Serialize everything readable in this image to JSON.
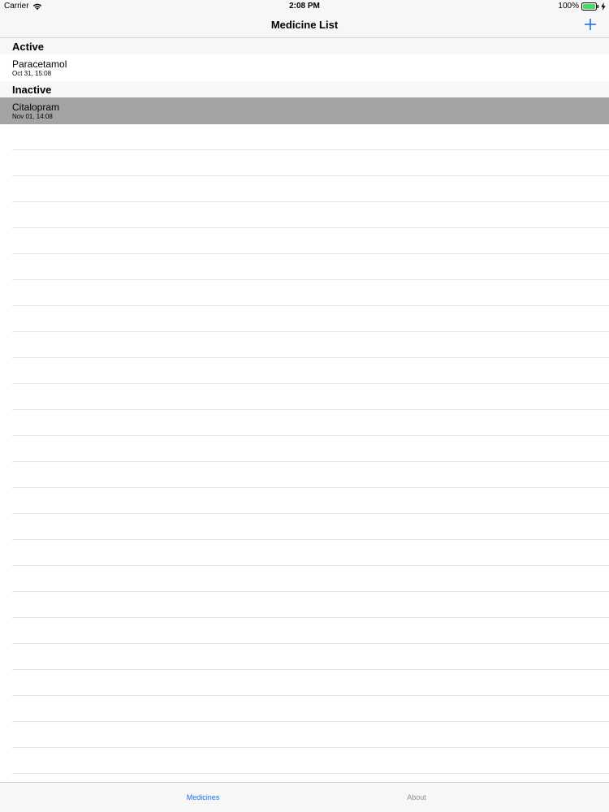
{
  "status_bar": {
    "carrier": "Carrier",
    "time": "2:08 PM",
    "battery": "100%"
  },
  "nav": {
    "title": "Medicine List",
    "add_icon": "plus-icon"
  },
  "colors": {
    "accent": "#1a73e8",
    "selected_row": "#a3a3a3",
    "battery_green": "#4cd964",
    "inactive_tab": "#8e8e93"
  },
  "sections": [
    {
      "header": "Active",
      "items": [
        {
          "name": "Paracetamol",
          "date": "Oct 31, 15:08"
        }
      ]
    },
    {
      "header": "Inactive",
      "items": [
        {
          "name": "Citalopram",
          "date": "Nov 01, 14:08"
        }
      ]
    }
  ],
  "tabs": {
    "medicines": "Medicines",
    "about": "About"
  }
}
